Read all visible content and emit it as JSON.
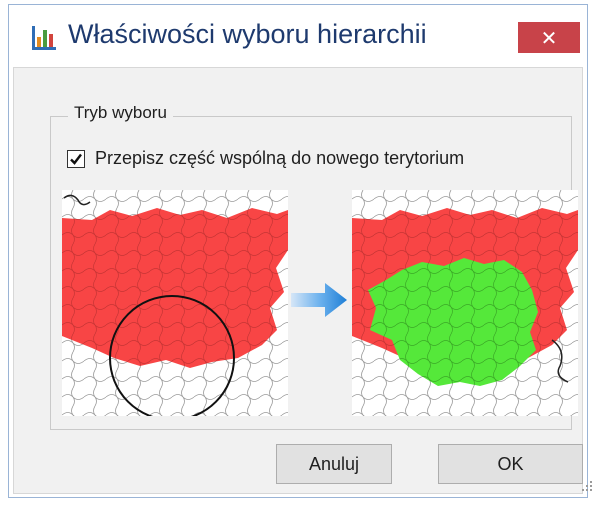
{
  "window": {
    "title": "Właściwości wyboru hierarchii",
    "title_icon": "chart-icon",
    "close_icon": "close-icon",
    "close_glyph": "✕"
  },
  "group": {
    "legend": "Tryb wyboru",
    "checkbox": {
      "checked": true,
      "label": "Przepisz część wspólną do nowego terytorium"
    }
  },
  "illustration": {
    "before_image": "map-before-icon",
    "arrow": "arrow-right-icon",
    "after_image": "map-after-icon",
    "colors": {
      "region": "#f84545",
      "selection": "#55e83a",
      "circle": "#111111"
    }
  },
  "buttons": {
    "cancel_label": "Anuluj",
    "ok_label": "OK"
  },
  "colors": {
    "title_text": "#1e3a6e",
    "close_bg": "#c84349",
    "button_bg": "#e1e1e1",
    "client_bg": "#f1f1f1"
  }
}
